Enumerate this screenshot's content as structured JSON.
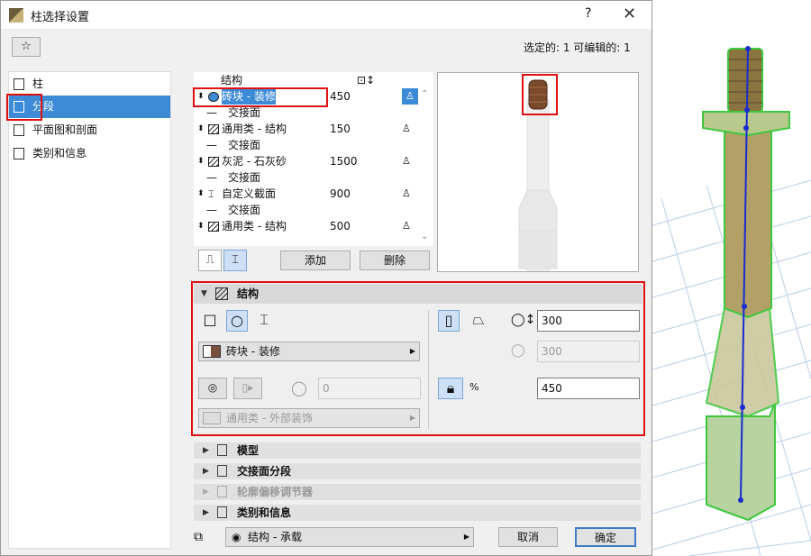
{
  "window": {
    "title": "柱选择设置",
    "help": "?",
    "close": "✕"
  },
  "toolbar": {
    "favorites_icon": "favorites-icon"
  },
  "selection_info": "选定的: 1 可编辑的: 1",
  "sidebar": {
    "items": [
      {
        "label": "柱",
        "icon": "column-icon"
      },
      {
        "label": "分段",
        "icon": "segments-icon",
        "selected": true
      },
      {
        "label": "平面图和剖面",
        "icon": "floorplan-icon"
      },
      {
        "label": "类别和信息",
        "icon": "info-icon"
      }
    ]
  },
  "segments": {
    "header": {
      "label": "结构"
    },
    "rows": [
      {
        "type": "segment",
        "label": "砖块 - 装修",
        "value": "450",
        "selected": true
      },
      {
        "type": "connection",
        "label": "交接面"
      },
      {
        "type": "segment",
        "label": "通用类 - 结构",
        "value": "150"
      },
      {
        "type": "connection",
        "label": "交接面"
      },
      {
        "type": "segment",
        "label": "灰泥 - 石灰砂",
        "value": "1500"
      },
      {
        "type": "connection",
        "label": "交接面"
      },
      {
        "type": "segment",
        "label": "自定义截面",
        "value": "900"
      },
      {
        "type": "connection",
        "label": "交接面"
      },
      {
        "type": "segment",
        "label": "通用类 - 结构",
        "value": "500"
      }
    ],
    "add_button": "添加",
    "delete_button": "删除"
  },
  "structure_panel": {
    "title": "结构",
    "material_dropdown": "砖块 - 装修",
    "cover_value": "0",
    "cover_dropdown": "通用类 - 外部装饰",
    "width_value": "300",
    "depth_value": "300",
    "height_value": "450"
  },
  "collapsed_sections": [
    {
      "label": "模型",
      "disabled": false
    },
    {
      "label": "交接面分段",
      "disabled": false
    },
    {
      "label": "轮廓偏移调节器",
      "disabled": true
    },
    {
      "label": "类别和信息",
      "disabled": false
    }
  ],
  "footer": {
    "layer_dropdown": "结构 - 承载",
    "cancel_button": "取消",
    "ok_button": "确定"
  },
  "colors": {
    "selection": "#3d8bd6",
    "highlight": "#e01010",
    "model_green": "#3ec83e"
  }
}
